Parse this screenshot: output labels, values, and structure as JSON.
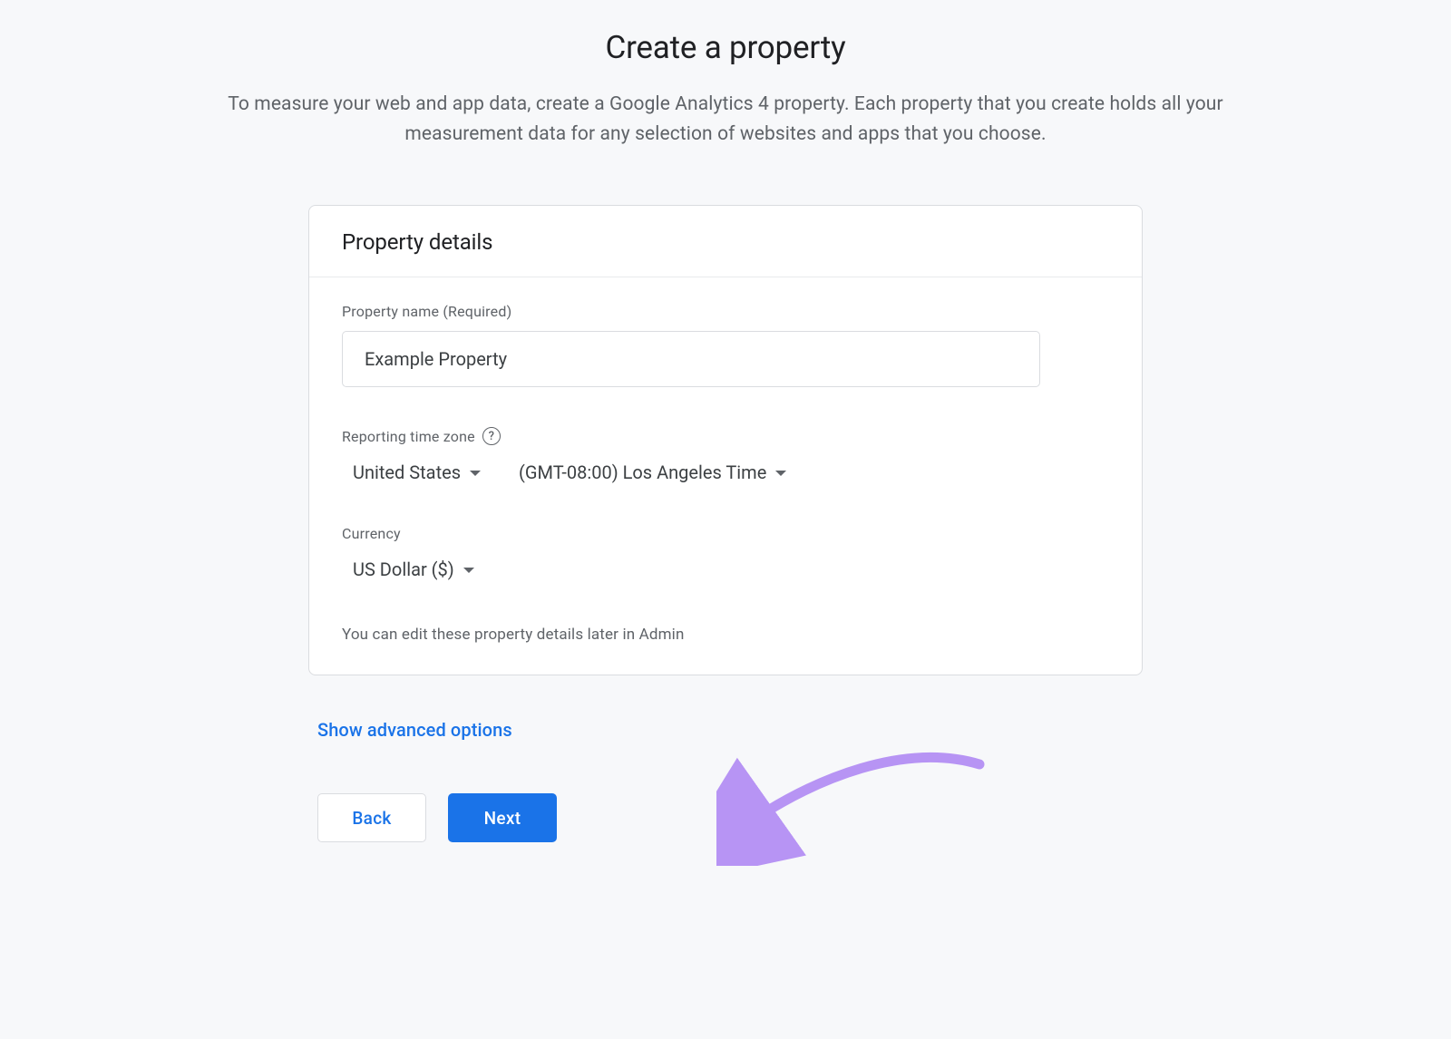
{
  "header": {
    "title": "Create a property",
    "subtitle": "To measure your web and app data, create a Google Analytics 4 property. Each property that you create holds all your measurement data for any selection of websites and apps that you choose."
  },
  "card": {
    "title": "Property details",
    "property_name": {
      "label": "Property name (Required)",
      "value": "Example Property"
    },
    "timezone": {
      "label": "Reporting time zone",
      "country": "United States",
      "tz": "(GMT-08:00) Los Angeles Time"
    },
    "currency": {
      "label": "Currency",
      "value": "US Dollar ($)"
    },
    "hint": "You can edit these property details later in Admin"
  },
  "advanced_link": "Show advanced options",
  "buttons": {
    "back": "Back",
    "next": "Next"
  },
  "annotation": {
    "arrow_color": "#b794f4"
  }
}
